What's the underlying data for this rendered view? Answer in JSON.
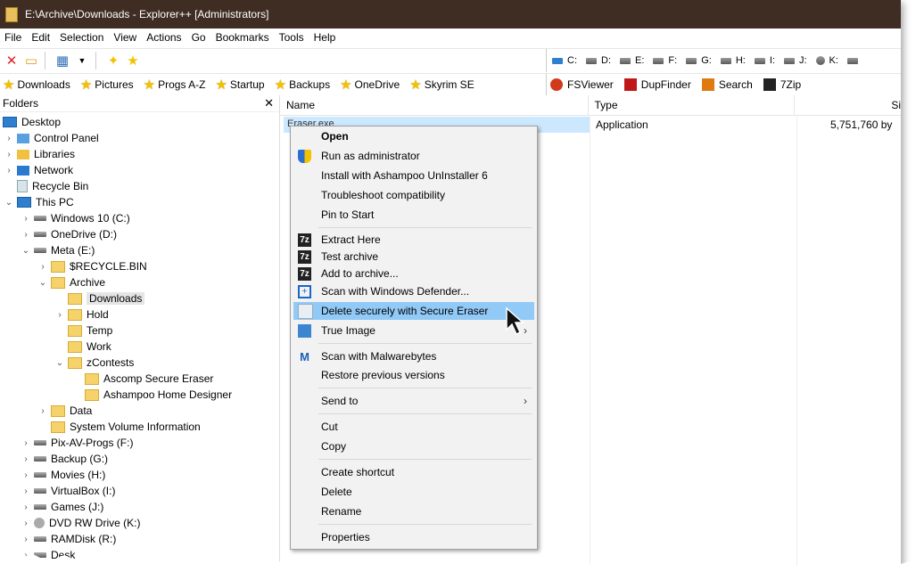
{
  "window": {
    "title": "E:\\Archive\\Downloads - Explorer++ [Administrators]"
  },
  "menu": [
    "File",
    "Edit",
    "Selection",
    "View",
    "Actions",
    "Go",
    "Bookmarks",
    "Tools",
    "Help"
  ],
  "drives": [
    "C:",
    "D:",
    "E:",
    "F:",
    "G:",
    "H:",
    "I:",
    "J:",
    "K:"
  ],
  "bookmarks": [
    "Downloads",
    "Pictures",
    "Progs A-Z",
    "Startup",
    "Backups",
    "OneDrive",
    "Skyrim SE"
  ],
  "apps": [
    "FSViewer",
    "DupFinder",
    "Search",
    "7Zip"
  ],
  "folders_pane": {
    "title": "Folders",
    "tree": [
      {
        "label": "Desktop",
        "level": 0
      },
      {
        "label": "Control Panel",
        "level": 1
      },
      {
        "label": "Libraries",
        "level": 1
      },
      {
        "label": "Network",
        "level": 1
      },
      {
        "label": "Recycle Bin",
        "level": 1
      },
      {
        "label": "This PC",
        "level": 1
      },
      {
        "label": "Windows 10 (C:)",
        "level": 2
      },
      {
        "label": "OneDrive (D:)",
        "level": 2
      },
      {
        "label": "Meta (E:)",
        "level": 2
      },
      {
        "label": "$RECYCLE.BIN",
        "level": 3
      },
      {
        "label": "Archive",
        "level": 3
      },
      {
        "label": "Downloads",
        "level": 4,
        "selected": true
      },
      {
        "label": "Hold",
        "level": 4
      },
      {
        "label": "Temp",
        "level": 4
      },
      {
        "label": "Work",
        "level": 4
      },
      {
        "label": "zContests",
        "level": 4
      },
      {
        "label": "Ascomp Secure Eraser",
        "level": 5
      },
      {
        "label": "Ashampoo Home Designer",
        "level": 5
      },
      {
        "label": "Data",
        "level": 3
      },
      {
        "label": "System Volume Information",
        "level": 3
      },
      {
        "label": "Pix-AV-Progs (F:)",
        "level": 2
      },
      {
        "label": "Backup (G:)",
        "level": 2
      },
      {
        "label": "Movies (H:)",
        "level": 2
      },
      {
        "label": "VirtualBox (I:)",
        "level": 2
      },
      {
        "label": "Games (J:)",
        "level": 2
      },
      {
        "label": "DVD RW Drive (K:)",
        "level": 2
      },
      {
        "label": "RAMDisk (R:)",
        "level": 2
      },
      {
        "label": "Desk",
        "level": 2
      }
    ]
  },
  "file_list": {
    "columns": [
      "Name",
      "Type",
      "Si"
    ],
    "rows": [
      {
        "name": "Eraser.exe",
        "type": "Application",
        "size": "5,751,760 by"
      }
    ]
  },
  "context_menu": {
    "items": [
      {
        "label": "Open",
        "icon": ""
      },
      {
        "label": "Run as administrator",
        "icon": "shield-icon"
      },
      {
        "label": "Install with Ashampoo UnInstaller 6",
        "icon": ""
      },
      {
        "label": "Troubleshoot compatibility",
        "icon": ""
      },
      {
        "label": "Pin to Start",
        "icon": ""
      },
      {
        "label": "Extract Here",
        "icon": "7zip-icon"
      },
      {
        "label": "Test archive",
        "icon": "7zip-icon"
      },
      {
        "label": "Add to archive...",
        "icon": "7zip-icon"
      },
      {
        "label": "Scan with Windows Defender...",
        "icon": "defender-icon"
      },
      {
        "label": "Delete securely with Secure Eraser",
        "icon": "eraser-icon",
        "highlighted": true
      },
      {
        "label": "True Image",
        "icon": "true-image-icon",
        "submenu": true
      },
      {
        "label": "Scan with Malwarebytes",
        "icon": "malwarebytes-icon"
      },
      {
        "label": "Restore previous versions",
        "icon": ""
      },
      {
        "label": "Send to",
        "icon": "",
        "submenu": true
      },
      {
        "label": "Cut",
        "icon": ""
      },
      {
        "label": "Copy",
        "icon": ""
      },
      {
        "label": "Create shortcut",
        "icon": ""
      },
      {
        "label": "Delete",
        "icon": ""
      },
      {
        "label": "Rename",
        "icon": ""
      },
      {
        "label": "Properties",
        "icon": ""
      }
    ]
  },
  "colors": {
    "titlebar": "#3f2d23",
    "selection": "#cce8ff",
    "menu_highlight": "#91c9f7"
  }
}
